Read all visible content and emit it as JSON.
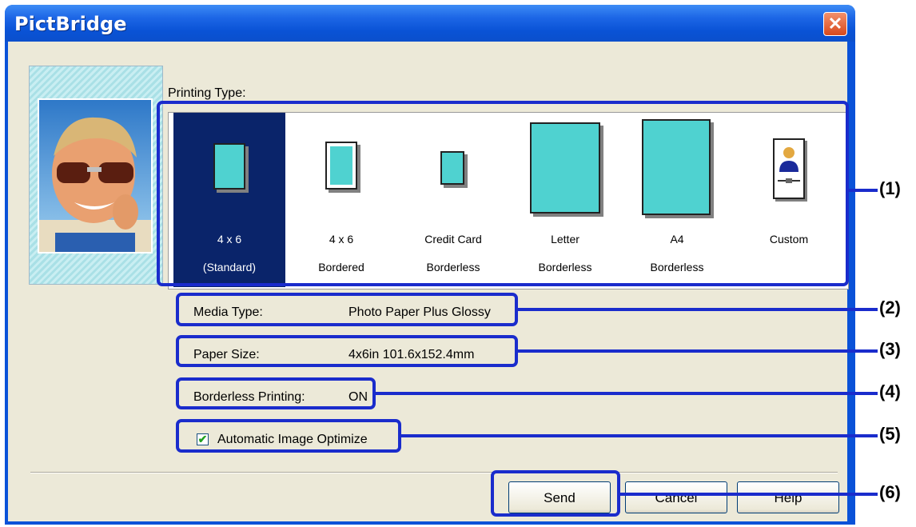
{
  "window": {
    "title": "PictBridge",
    "close_label": "✕"
  },
  "printing_type": {
    "label": "Printing Type:",
    "options": [
      {
        "line1": "4 x 6",
        "line2": "(Standard)",
        "selected": true
      },
      {
        "line1": "4 x 6",
        "line2": "Bordered",
        "selected": false
      },
      {
        "line1": "Credit Card",
        "line2": "Borderless",
        "selected": false
      },
      {
        "line1": "Letter",
        "line2": "Borderless",
        "selected": false
      },
      {
        "line1": "A4",
        "line2": "Borderless",
        "selected": false
      },
      {
        "line1": "Custom",
        "line2": "",
        "selected": false
      }
    ]
  },
  "media_type": {
    "label": "Media Type:",
    "value": "Photo Paper Plus Glossy"
  },
  "paper_size": {
    "label": "Paper Size:",
    "value": "4x6in 101.6x152.4mm"
  },
  "borderless": {
    "label": "Borderless Printing:",
    "value": "ON"
  },
  "auto_optimize": {
    "label": "Automatic Image Optimize",
    "checked": true,
    "check_glyph": "✔"
  },
  "buttons": {
    "send": "Send",
    "cancel": "Cancel",
    "help": "Help"
  },
  "callouts": [
    "(1)",
    "(2)",
    "(3)",
    "(4)",
    "(5)",
    "(6)"
  ],
  "colors": {
    "annotation": "#1a2ccc",
    "selection": "#0a246a",
    "paper": "#4fd2d0",
    "dialog_bg": "#ece9d8"
  }
}
